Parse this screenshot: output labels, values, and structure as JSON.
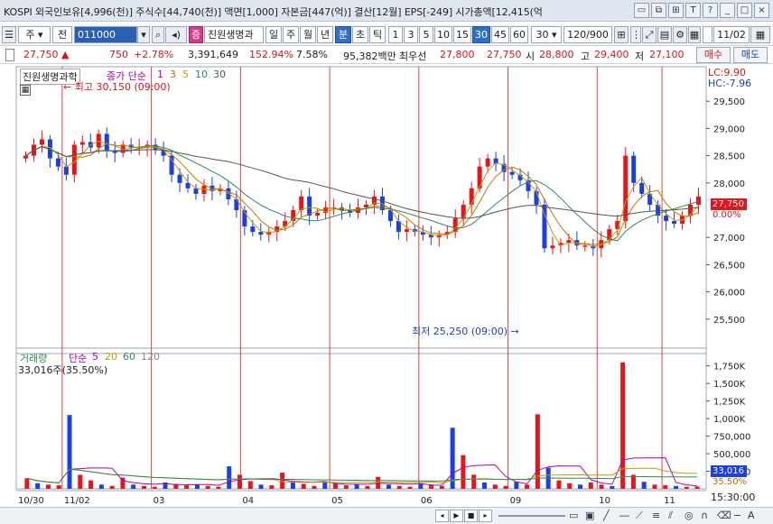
{
  "info_bar": {
    "text": "KOSPI 외국인보유[4,996(천)] 주식수[44,740(천)] 액면[1,000] 자본금[447(억)] 결산[12월] EPS[-249] 시가총액[12,415(억",
    "icons": [
      "window-icon",
      "restore-icon",
      "pin-icon",
      "font-icon",
      "help-icon",
      "minimize-icon",
      "maximize-icon",
      "close-icon"
    ]
  },
  "toolbar": {
    "stock_type": "주",
    "prev_label": "전",
    "code": "011000",
    "sound": "◂",
    "badge": "증",
    "name": "진원생명과",
    "periods": [
      "일",
      "주",
      "월",
      "년",
      "분",
      "초",
      "틱"
    ],
    "active_period": "분",
    "intervals": [
      "1",
      "3",
      "5",
      "10",
      "15",
      "30",
      "45",
      "60"
    ],
    "active_interval": "30",
    "interval_select": "30",
    "count": "120/900",
    "date": "11/02"
  },
  "price_row": {
    "price": "27,750",
    "change": "750",
    "change_pct": "+2.78%",
    "volume": "3,391,649",
    "volume_ratio": "152.94%",
    "turnover": "7.58%",
    "amount": "95,382백만",
    "type": "최우선",
    "ask": "27,800",
    "bid": "27,750",
    "open_label": "시",
    "open": "28,800",
    "high_label": "고",
    "high": "29,400",
    "low_label": "저",
    "low": "27,100",
    "buy": "매수",
    "sell": "매도"
  },
  "price_panel": {
    "name_label": "진원생명과학",
    "ma_label": "종가 단순",
    "ma_periods": [
      "1",
      "3",
      "5",
      "10",
      "30"
    ],
    "lc": "LC:9.90",
    "hc": "HC:-7.96",
    "high_note": "최고 30,150 (09:00)",
    "low_note": "최저 25,250 (09:00)",
    "current_price_tag": "27,750",
    "current_pct_tag": "0.00%",
    "y_ticks": [
      "29,500",
      "29,000",
      "28,500",
      "28,000",
      "27,000",
      "26,500",
      "26,000",
      "25,500"
    ]
  },
  "volume_panel": {
    "label": "거래량",
    "ma_label": "단순",
    "ma_periods": [
      "5",
      "20",
      "60",
      "120"
    ],
    "current": "33,016주(35.50%)",
    "y_ticks": [
      "1,750K",
      "1,500K",
      "1,250K",
      "1,000K",
      "750,000",
      "500,000",
      "250,000"
    ],
    "current_tag": "33,016",
    "current_pct_tag": "35.50%"
  },
  "x_axis": {
    "labels": [
      "10/30",
      "11/02",
      "03",
      "04",
      "05",
      "06",
      "09",
      "10",
      "11"
    ],
    "time": "15:30:00"
  },
  "colors": {
    "up": "#e8131b",
    "down": "#1b3fe0",
    "ma3": "#c89a00",
    "ma5": "#c07a00",
    "ma10": "#2e8b57",
    "ma30": "#555555",
    "vol_ma5": "#b000b0",
    "vol_ma20": "#c89a00",
    "vol_ma60": "#2e8b57"
  },
  "chart_data": {
    "type": "candlestick",
    "x": [
      "10/30",
      "11/02",
      "03",
      "04",
      "05",
      "06",
      "09",
      "10",
      "11"
    ],
    "price_series": {
      "close": [
        28500,
        28700,
        28800,
        28450,
        28300,
        28150,
        28700,
        28750,
        28650,
        28900,
        28600,
        28550,
        28700,
        28650,
        28650,
        28700,
        28600,
        28500,
        28150,
        28000,
        27900,
        27800,
        27950,
        27850,
        27900,
        27700,
        27500,
        27200,
        27100,
        27050,
        27100,
        27200,
        27300,
        27500,
        27750,
        27400,
        27450,
        27550,
        27550,
        27500,
        27450,
        27550,
        27600,
        27750,
        27500,
        27300,
        27100,
        27150,
        27100,
        27050,
        27000,
        27050,
        27100,
        27350,
        27600,
        27900,
        28300,
        28450,
        28350,
        28200,
        28150,
        28050,
        27850,
        27600,
        26800,
        26850,
        26900,
        26950,
        26850,
        26850,
        26800,
        26950,
        27150,
        27300,
        28500,
        28000,
        27800,
        27600,
        27400,
        27300,
        27250,
        27400,
        27600,
        27750
      ],
      "ylim": [
        25000,
        30000
      ]
    },
    "volume_series": {
      "values": [
        150000,
        80000,
        60000,
        50000,
        1050000,
        200000,
        120000,
        60000,
        40000,
        160000,
        60000,
        40000,
        30000,
        90000,
        70000,
        50000,
        60000,
        40000,
        30000,
        320000,
        200000,
        110000,
        60000,
        50000,
        230000,
        90000,
        70000,
        40000,
        100000,
        80000,
        50000,
        60000,
        40000,
        170000,
        60000,
        40000,
        30000,
        80000,
        60000,
        40000,
        870000,
        480000,
        200000,
        90000,
        60000,
        40000,
        100000,
        60000,
        1060000,
        300000,
        120000,
        80000,
        60000,
        90000,
        60000,
        40000,
        1800000,
        200000,
        100000,
        60000,
        50000,
        40000,
        30000,
        33016
      ],
      "ylim": [
        0,
        1900000
      ]
    },
    "high_note_value": 30150,
    "low_note_value": 25250,
    "grid": false
  },
  "bottom_bar": {
    "buttons": [
      "◂",
      "▸",
      "▶",
      "■",
      "▸▸",
      "◂▸"
    ]
  }
}
